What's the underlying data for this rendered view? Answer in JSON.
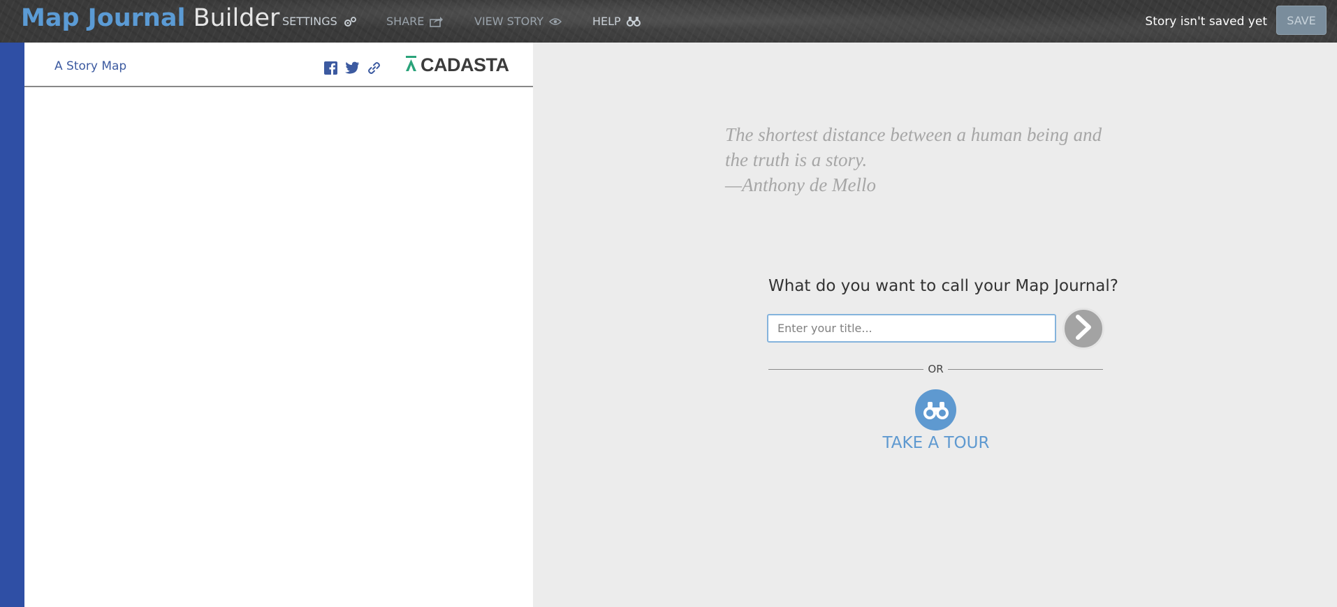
{
  "header": {
    "brand_primary": "Map Journal",
    "brand_secondary": "Builder",
    "nav": {
      "settings": "SETTINGS",
      "share": "SHARE",
      "view_story": "VIEW STORY",
      "help": "HELP"
    },
    "status": "Story isn't saved yet",
    "save_label": "SAVE"
  },
  "side_panel": {
    "title": "A Story Map",
    "social_icons": [
      "facebook-icon",
      "twitter-icon",
      "link-icon"
    ],
    "logo_text": "CADASTA"
  },
  "main": {
    "quote_lines": [
      "The shortest distance between a human being and",
      "the truth is a story.",
      "—Anthony de Mello"
    ],
    "prompt": "What do you want to call your Map Journal?",
    "title_placeholder": "Enter your title...",
    "or_label": "OR",
    "tour_label": "TAKE A TOUR"
  },
  "colors": {
    "brand_blue": "#5b9bd5",
    "left_strip": "#2f4fa5",
    "accent_blue": "#5e99d0",
    "cadasta_green": "#2aa37a"
  }
}
